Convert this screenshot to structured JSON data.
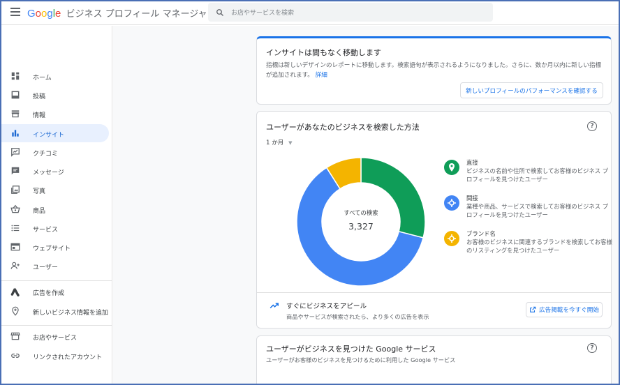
{
  "header": {
    "logo_google": "Google",
    "app_name": "ビジネス プロフィール マネージャ",
    "search_placeholder": "お店やサービスを検索"
  },
  "sidebar": {
    "items": [
      {
        "label": "ホーム",
        "icon": "dashboard-icon"
      },
      {
        "label": "投稿",
        "icon": "post-icon"
      },
      {
        "label": "情報",
        "icon": "store-icon"
      },
      {
        "label": "インサイト",
        "icon": "bar-chart-icon",
        "active": true
      },
      {
        "label": "クチコミ",
        "icon": "review-icon"
      },
      {
        "label": "メッセージ",
        "icon": "message-icon"
      },
      {
        "label": "写真",
        "icon": "photo-icon"
      },
      {
        "label": "商品",
        "icon": "basket-icon"
      },
      {
        "label": "サービス",
        "icon": "list-icon"
      },
      {
        "label": "ウェブサイト",
        "icon": "web-icon"
      },
      {
        "label": "ユーザー",
        "icon": "add-user-icon"
      },
      {
        "label": "広告を作成",
        "icon": "ads-icon"
      },
      {
        "label": "新しいビジネス情報を追加",
        "icon": "add-location-icon"
      },
      {
        "label": "お店やサービス",
        "icon": "storefront-icon"
      },
      {
        "label": "リンクされたアカウント",
        "icon": "link-icon"
      }
    ]
  },
  "notice": {
    "title": "インサイトは間もなく移動します",
    "body": "指標は新しいデザインのレポートに移動します。検索語句が表示されるようになりました。さらに、数か月以内に新しい指標が追加されます。",
    "link": "詳細",
    "button": "新しいプロフィールのパフォーマンスを確認する"
  },
  "search_card": {
    "title": "ユーザーがあなたのビジネスを検索した方法",
    "period": "1 か月",
    "center_label": "すべての検索",
    "center_value": "3,327",
    "legend": [
      {
        "title": "直接",
        "desc": "ビジネスの名前や住所で検索してお客様のビジネス プロフィールを見つけたユーザー",
        "color": "#0f9d58"
      },
      {
        "title": "間接",
        "desc": "業種や商品、サービスで検索してお客様のビジネス プロフィールを見つけたユーザー",
        "color": "#4285f4"
      },
      {
        "title": "ブランド名",
        "desc": "お客様のビジネスに関連するブランドを検索してお客様のリスティングを見つけたユーザー",
        "color": "#f4b400"
      }
    ],
    "promo_title": "すぐにビジネスをアピール",
    "promo_desc": "商品やサービスが検索されたら、より多くの広告を表示",
    "promo_button": "広告掲載を今すぐ開始"
  },
  "services_card": {
    "title": "ユーザーがビジネスを見つけた Google サービス",
    "subtitle": "ユーザーがお客様のビジネスを見つけるために利用した Google サービス"
  },
  "chart_data": {
    "type": "pie",
    "title": "ユーザーがあなたのビジネスを検索した方法",
    "categories": [
      "直接",
      "間接",
      "ブランド名"
    ],
    "values": [
      29,
      62,
      9
    ],
    "colors": [
      "#0f9d58",
      "#4285f4",
      "#f4b400"
    ],
    "total": 3327
  }
}
